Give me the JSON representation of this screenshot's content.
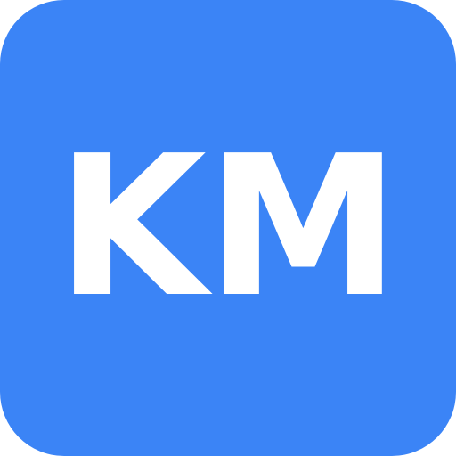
{
  "icon": {
    "monogram": "KM",
    "background_color": "#3b84f6",
    "text_color": "#ffffff"
  }
}
